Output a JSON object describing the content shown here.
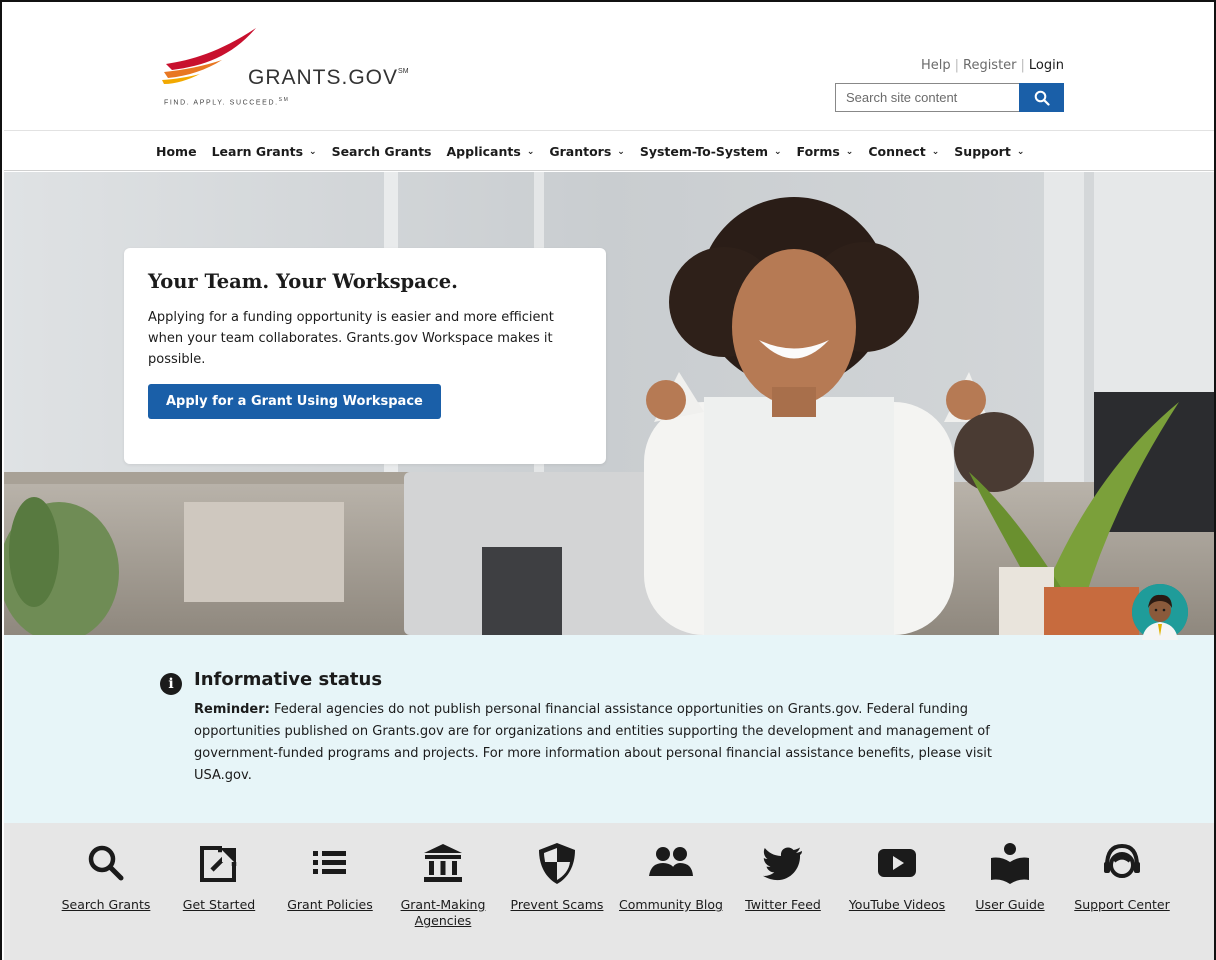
{
  "header": {
    "logo": {
      "wordmark": "GRANTS.GOV",
      "trademark": "SM",
      "tagline": "FIND. APPLY. SUCCEED.",
      "tagline_mark": "SM"
    },
    "util_links": [
      {
        "label": "Help"
      },
      {
        "label": "Register"
      },
      {
        "label": "Login"
      }
    ],
    "search": {
      "placeholder": "Search site content",
      "icon": "search-icon"
    }
  },
  "nav": {
    "items": [
      {
        "label": "Home",
        "dropdown": false
      },
      {
        "label": "Learn Grants",
        "dropdown": true
      },
      {
        "label": "Search Grants",
        "dropdown": false
      },
      {
        "label": "Applicants",
        "dropdown": true
      },
      {
        "label": "Grantors",
        "dropdown": true
      },
      {
        "label": "System-To-System",
        "dropdown": true
      },
      {
        "label": "Forms",
        "dropdown": true
      },
      {
        "label": "Connect",
        "dropdown": true
      },
      {
        "label": "Support",
        "dropdown": true
      }
    ]
  },
  "hero": {
    "title": "Your Team. Your Workspace.",
    "body": "Applying for a funding opportunity is easier and more efficient when your team collaborates. Grants.gov Workspace makes it possible.",
    "cta": "Apply for a Grant Using Workspace"
  },
  "alert": {
    "icon": "info-icon",
    "title": "Informative status",
    "lead": "Reminder:",
    "body": " Federal agencies do not publish personal financial assistance opportunities on Grants.gov. Federal funding opportunities published on Grants.gov are for organizations and entities supporting the development and management of government-funded programs and projects. For more information about personal financial assistance benefits, please visit USA.gov."
  },
  "quick_links": [
    {
      "label": "Search Grants",
      "icon": "search-icon"
    },
    {
      "label": "Get Started",
      "icon": "external-link-icon"
    },
    {
      "label": "Grant Policies",
      "icon": "list-icon"
    },
    {
      "label": "Grant-Making Agencies",
      "icon": "bank-icon"
    },
    {
      "label": "Prevent Scams",
      "icon": "shield-icon"
    },
    {
      "label": "Community Blog",
      "icon": "people-icon"
    },
    {
      "label": "Twitter Feed",
      "icon": "twitter-icon"
    },
    {
      "label": "YouTube Videos",
      "icon": "youtube-icon"
    },
    {
      "label": "User Guide",
      "icon": "user-guide-icon"
    },
    {
      "label": "Support Center",
      "icon": "support-agent-icon"
    }
  ],
  "colors": {
    "primary": "#1a5fa8",
    "alert_bg": "#e7f5f8",
    "quick_bg": "#e6e6e6",
    "logo_red": "#c8102e",
    "logo_orange": "#e87722"
  }
}
